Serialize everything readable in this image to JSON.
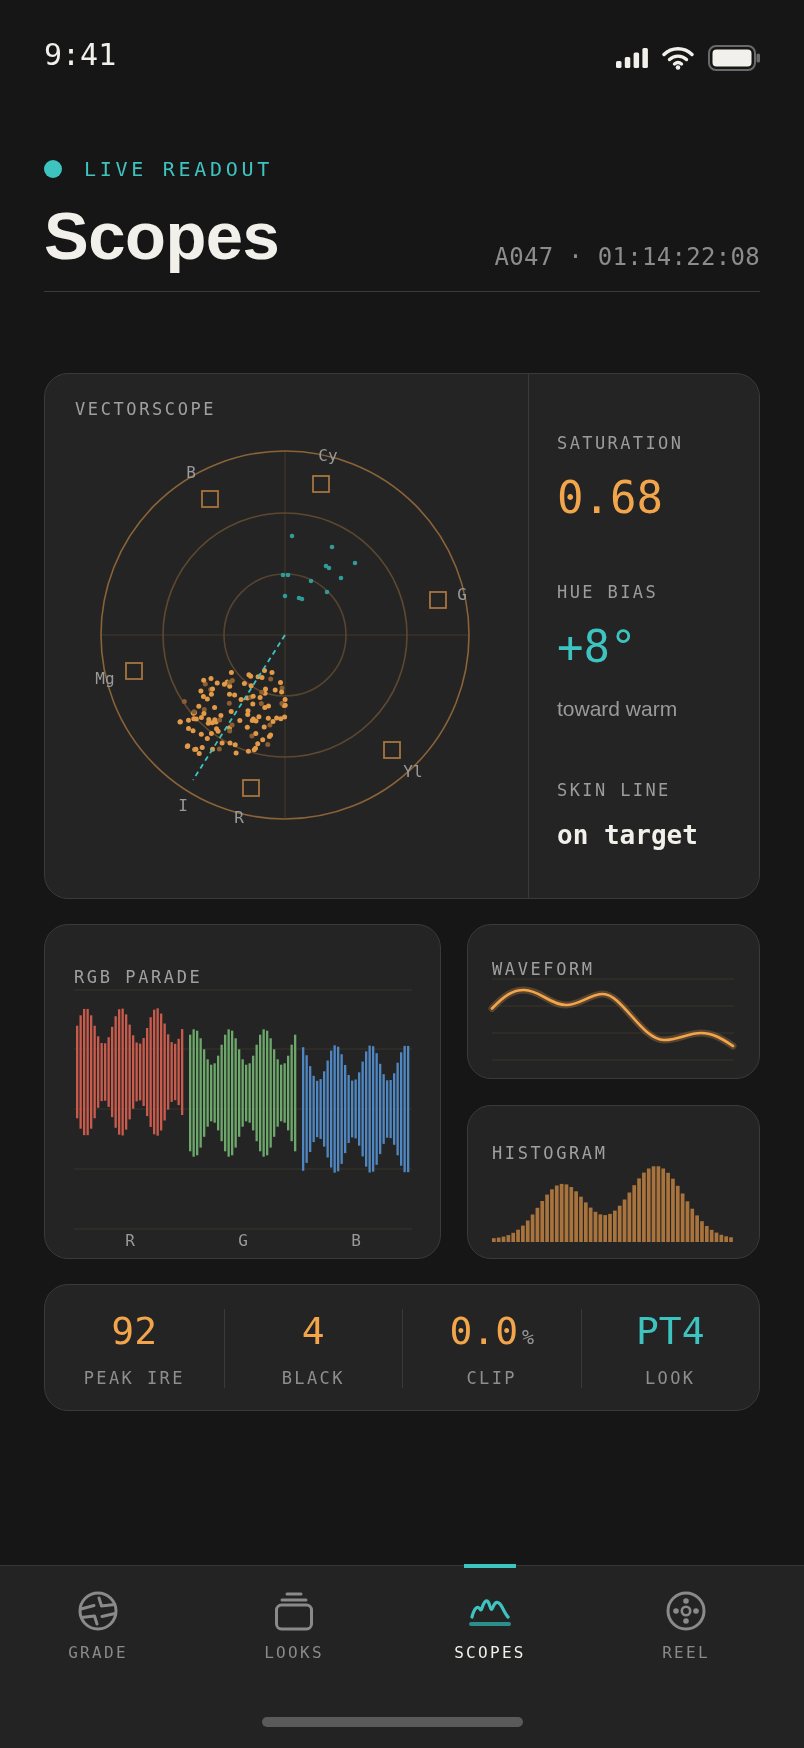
{
  "status_bar": {
    "time": "9:41"
  },
  "header": {
    "live": true,
    "eyebrow": "LIVE READOUT",
    "title": "Scopes",
    "clip": "A047 · 01:14:22:08"
  },
  "vectorscope": {
    "title": "VECTORSCOPE",
    "targets": [
      {
        "label": "Cy"
      },
      {
        "label": "B"
      },
      {
        "label": "G"
      },
      {
        "label": "Mg"
      },
      {
        "label": "Yl"
      },
      {
        "label": "R"
      }
    ],
    "skin_line": {
      "label": "I"
    },
    "readouts": [
      {
        "kind": "metric",
        "label": "SATURATION",
        "value": "0.68",
        "color": "#f2a54a"
      },
      {
        "kind": "metric",
        "label": "HUE BIAS",
        "value": "+8°",
        "note": "toward warm",
        "color": "#3ec4c0"
      },
      {
        "kind": "status",
        "label": "SKIN LINE",
        "value": "on target",
        "color": "#f2f0ea"
      }
    ]
  },
  "parade": {
    "title": "RGB PARADE",
    "channels": [
      {
        "label": "R",
        "color": "#c95b4d"
      },
      {
        "label": "G",
        "color": "#6ca86a"
      },
      {
        "label": "B",
        "color": "#4f87c2"
      }
    ]
  },
  "waveform": {
    "title": "WAVEFORM"
  },
  "histogram": {
    "title": "HISTOGRAM"
  },
  "stats": [
    {
      "value": "92",
      "label": "PEAK IRE",
      "color": "#f2a54a"
    },
    {
      "value": "4",
      "label": "BLACK",
      "color": "#f2a54a"
    },
    {
      "value": "0.0",
      "unit": "%",
      "label": "CLIP",
      "color": "#f2a54a"
    },
    {
      "value": "PT4",
      "label": "LOOK",
      "color": "#3ec4c0"
    }
  ],
  "tabs": [
    {
      "label": "GRADE",
      "selected": false
    },
    {
      "label": "LOOKS",
      "selected": false
    },
    {
      "label": "SCOPES",
      "selected": true
    },
    {
      "label": "REEL",
      "selected": false
    }
  ]
}
